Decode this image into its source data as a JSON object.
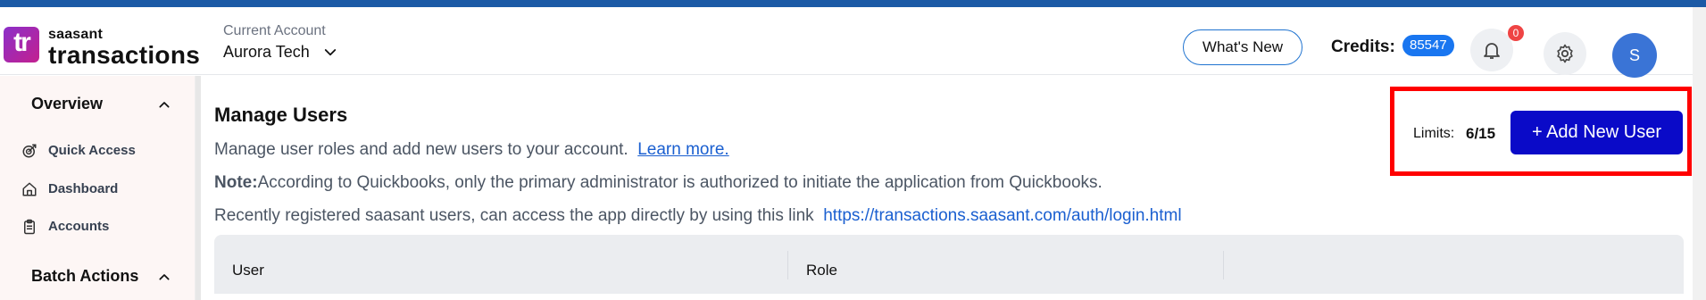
{
  "header": {
    "logo_mark": "tr",
    "logo_small": "saasant",
    "logo_big": "transactions",
    "account_label": "Current Account",
    "account_name": "Aurora Tech",
    "whats_new": "What's New",
    "credits_label": "Credits:",
    "credits_value": "85547",
    "notification_count": "0",
    "avatar_initial": "S"
  },
  "sidebar": {
    "sections": [
      {
        "label": "Overview",
        "items": [
          "Quick Access",
          "Dashboard",
          "Accounts"
        ]
      },
      {
        "label": "Batch Actions",
        "items": []
      }
    ]
  },
  "main": {
    "title": "Manage Users",
    "description": "Manage user roles and add new users to your account.",
    "learn_more": "Learn more.",
    "note_label": "Note:",
    "note_text": "According to Quickbooks, only the primary administrator is authorized to initiate the application from Quickbooks.",
    "recent_text": "Recently registered saasant users, can access the app directly by using this link",
    "login_link": "https://transactions.saasant.com/auth/login.html",
    "limits_label": "Limits:",
    "limits_value": "6/15",
    "add_user_button": "+ Add New User",
    "table_headers": [
      "User",
      "Role",
      ""
    ]
  },
  "colors": {
    "accent": "#0a0ac8",
    "link": "#1a5fd0",
    "credits_badge": "#1976f0",
    "highlight_box": "#ff0000"
  }
}
